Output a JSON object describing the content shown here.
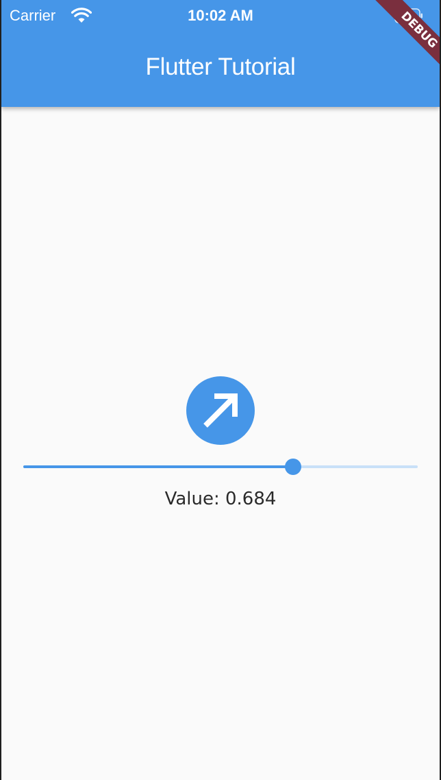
{
  "status_bar": {
    "carrier": "Carrier",
    "time": "10:02 AM"
  },
  "app_bar": {
    "title": "Flutter Tutorial"
  },
  "debug_banner": "DEBUG",
  "icon": {
    "name": "north-east-arrow-icon",
    "rotation_fraction": 0.684
  },
  "slider": {
    "value": 0.684,
    "min": 0,
    "max": 1
  },
  "value_label": "Value: 0.684",
  "colors": {
    "primary": "#4696e8",
    "track_inactive": "#c8e0f8",
    "background": "#fafafa",
    "debug_banner": "#7a2f3e"
  }
}
